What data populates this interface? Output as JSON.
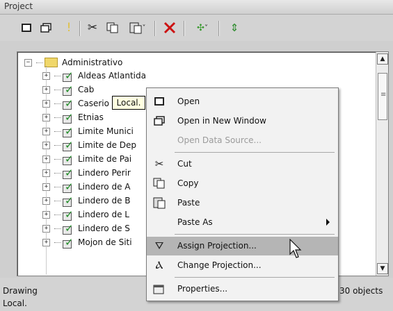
{
  "window": {
    "title": "Project"
  },
  "toolbar": {
    "icons": [
      "restore-icon",
      "cascade-icon",
      "info-icon",
      "scissors-icon",
      "copy-icon",
      "paste-icon",
      "delete-icon",
      "add-layer-icon",
      "sort-icon"
    ],
    "delete_color": "#cc1111"
  },
  "tree": {
    "root": "Administrativo",
    "items": [
      "Aldeas Atlantida",
      "Cab",
      "Caserio",
      "Etnias",
      "Limite Munici",
      "Limite de Dep",
      "Limite de Pai",
      "Lindero Perir",
      "Lindero de A",
      "Lindero de B",
      "Lindero de L",
      "Lindero de S",
      "Mojon de Siti"
    ]
  },
  "tooltip": {
    "text": "Local."
  },
  "context_menu": {
    "items": [
      {
        "label": "Open",
        "icon": "window-icon",
        "enabled": true
      },
      {
        "label": "Open in New Window",
        "icon": "new-window-icon",
        "enabled": true
      },
      {
        "label": "Open Data Source...",
        "icon": "",
        "enabled": false
      },
      {
        "label": "Cut",
        "icon": "scissors-icon",
        "enabled": true
      },
      {
        "label": "Copy",
        "icon": "copy-icon",
        "enabled": true
      },
      {
        "label": "Paste",
        "icon": "paste-icon",
        "enabled": true
      },
      {
        "label": "Paste As",
        "icon": "",
        "enabled": true,
        "submenu": true
      },
      {
        "label": "Assign Projection...",
        "icon": "projection-icon",
        "enabled": true,
        "highlighted": true
      },
      {
        "label": "Change Projection...",
        "icon": "projection-change-icon",
        "enabled": true
      },
      {
        "label": "Properties...",
        "icon": "properties-icon",
        "enabled": true
      }
    ]
  },
  "status": {
    "left": "Drawing",
    "right": "30 objects",
    "bottom": "Local."
  }
}
